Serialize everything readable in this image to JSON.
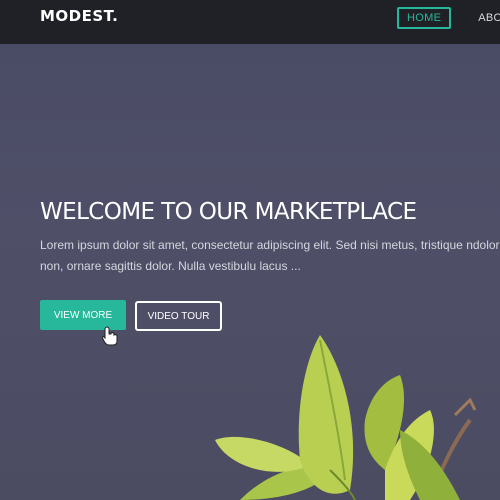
{
  "navbar": {
    "logo": "MODEST.",
    "items": [
      {
        "label": "HOME",
        "active": true
      },
      {
        "label": "ABOUT"
      }
    ]
  },
  "hero": {
    "title": "WELCOME TO OUR MARKETPLACE",
    "text": "Lorem ipsum dolor sit amet, consectetur adipiscing elit. Sed nisi metus, tristique ndolor non, ornare sagittis dolor. Nulla vestibulu lacus ...",
    "buttons": {
      "primary": "VIEW MORE",
      "secondary": "VIDEO TOUR"
    }
  },
  "colors": {
    "accent": "#27b79a",
    "navbar_bg": "#1f2127",
    "hero_bg": "#4a4b65"
  }
}
